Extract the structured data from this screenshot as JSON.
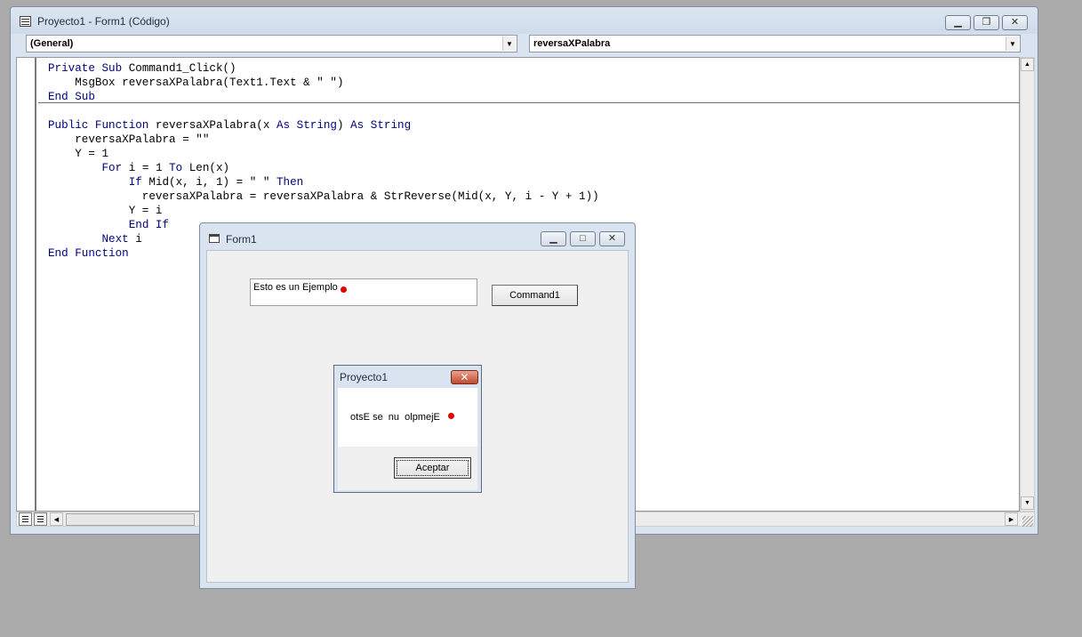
{
  "code_window": {
    "title": "Proyecto1 - Form1 (Código)",
    "object_combo": "(General)",
    "procedure_combo": "reversaXPalabra",
    "code_lines": [
      [
        {
          "t": "Private Sub",
          "k": true
        },
        {
          "t": " Command1_Click()"
        }
      ],
      [
        {
          "t": "    MsgBox reversaXPalabra(Text1.Text & \" \")"
        }
      ],
      [
        {
          "t": "End Sub",
          "k": true
        }
      ],
      [
        {
          "t": ""
        }
      ],
      [
        {
          "t": "Public Function",
          "k": true
        },
        {
          "t": " reversaXPalabra(x "
        },
        {
          "t": "As String",
          "k": true
        },
        {
          "t": ") "
        },
        {
          "t": "As String",
          "k": true
        }
      ],
      [
        {
          "t": "    reversaXPalabra = \"\""
        }
      ],
      [
        {
          "t": "    Y = 1"
        }
      ],
      [
        {
          "t": "        "
        },
        {
          "t": "For",
          "k": true
        },
        {
          "t": " i = 1 "
        },
        {
          "t": "To",
          "k": true
        },
        {
          "t": " Len(x)"
        }
      ],
      [
        {
          "t": "            "
        },
        {
          "t": "If",
          "k": true
        },
        {
          "t": " Mid(x, i, 1) = \" \" "
        },
        {
          "t": "Then",
          "k": true
        }
      ],
      [
        {
          "t": "              reversaXPalabra = reversaXPalabra & StrReverse(Mid(x, Y, i - Y + 1))"
        }
      ],
      [
        {
          "t": "            Y = i"
        }
      ],
      [
        {
          "t": "            "
        },
        {
          "t": "End If",
          "k": true
        }
      ],
      [
        {
          "t": "        "
        },
        {
          "t": "Next",
          "k": true
        },
        {
          "t": " i"
        }
      ],
      [
        {
          "t": "End Function",
          "k": true
        }
      ]
    ]
  },
  "form_window": {
    "title": "Form1",
    "text1_value": "Esto es un Ejemplo",
    "command1_label": "Command1"
  },
  "msgbox": {
    "title": "Proyecto1",
    "message": "otsE se  nu  olpmejE",
    "ok_label": "Aceptar"
  },
  "colors": {
    "keyword": "#00007f",
    "marker": "#e10000"
  },
  "icons": {
    "minimize": "minimize-icon",
    "maximize": "maximize-icon",
    "close": "close-icon"
  }
}
